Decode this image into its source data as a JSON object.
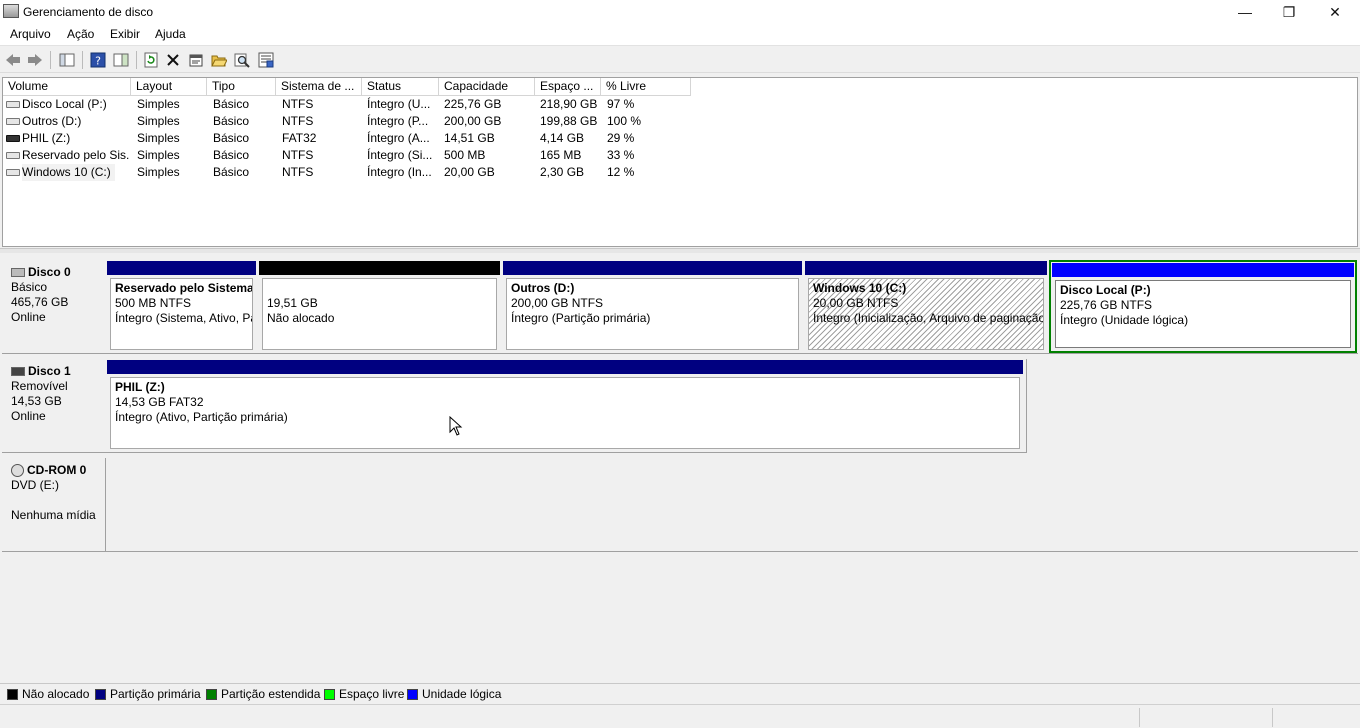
{
  "window": {
    "title": "Gerenciamento de disco",
    "minimize": "—",
    "restore": "❐",
    "close": "✕"
  },
  "menu": [
    "Arquivo",
    "Ação",
    "Exibir",
    "Ajuda"
  ],
  "toolbar": {
    "help_glyph": "?"
  },
  "volume_list": {
    "columns": [
      "Volume",
      "Layout",
      "Tipo",
      "Sistema de ...",
      "Status",
      "Capacidade",
      "Espaço ...",
      "% Livre"
    ],
    "rows": [
      {
        "volume": "Disco Local (P:)",
        "layout": "Simples",
        "tipo": "Básico",
        "fs": "NTFS",
        "status": "Íntegro (U...",
        "capacidade": "225,76 GB",
        "espaco": "218,90 GB",
        "livre": "97 %",
        "icon": "hard-drive-icon"
      },
      {
        "volume": "Outros (D:)",
        "layout": "Simples",
        "tipo": "Básico",
        "fs": "NTFS",
        "status": "Íntegro (P...",
        "capacidade": "200,00 GB",
        "espaco": "199,88 GB",
        "livre": "100 %",
        "icon": "hard-drive-icon"
      },
      {
        "volume": "PHIL (Z:)",
        "layout": "Simples",
        "tipo": "Básico",
        "fs": "FAT32",
        "status": "Íntegro (A...",
        "capacidade": "14,51 GB",
        "espaco": "4,14 GB",
        "livre": "29 %",
        "icon": "removable-drive-icon"
      },
      {
        "volume": "Reservado pelo Sis...",
        "layout": "Simples",
        "tipo": "Básico",
        "fs": "NTFS",
        "status": "Íntegro (Si...",
        "capacidade": "500 MB",
        "espaco": "165 MB",
        "livre": "33 %",
        "icon": "hard-drive-icon"
      },
      {
        "volume": "Windows 10 (C:)",
        "layout": "Simples",
        "tipo": "Básico",
        "fs": "NTFS",
        "status": "Íntegro (In...",
        "capacidade": "20,00 GB",
        "espaco": "2,30 GB",
        "livre": "12 %",
        "icon": "hard-drive-icon"
      }
    ]
  },
  "disks": [
    {
      "name": "Disco 0",
      "type": "Básico",
      "size": "465,76 GB",
      "state": "Online",
      "partitions": [
        {
          "kind": "primary",
          "name": "Reservado pelo Sistema",
          "size": "500 MB NTFS",
          "status": "Íntegro (Sistema, Ativo, Partição primária)"
        },
        {
          "kind": "unallocated",
          "name": "",
          "size": "19,51 GB",
          "status": "Não alocado"
        },
        {
          "kind": "primary",
          "name": "Outros  (D:)",
          "size": "200,00 GB NTFS",
          "status": "Íntegro (Partição primária)"
        },
        {
          "kind": "primary",
          "name": "Windows 10  (C:)",
          "size": "20,00 GB NTFS",
          "status": "Íntegro (Inicialização, Arquivo de paginação, Despejo de Memória, Partição primária)"
        },
        {
          "kind": "logical",
          "name": "Disco Local  (P:)",
          "size": "225,76 GB NTFS",
          "status": "Íntegro (Unidade lógica)"
        }
      ]
    },
    {
      "name": "Disco 1",
      "type": "Removível",
      "size": "14,53 GB",
      "state": "Online",
      "partitions": [
        {
          "kind": "primary",
          "name": "PHIL  (Z:)",
          "size": "14,53 GB FAT32",
          "status": "Íntegro (Ativo, Partição primária)"
        }
      ]
    },
    {
      "name": "CD-ROM 0",
      "type": "DVD (E:)",
      "size": "",
      "state": "Nenhuma mídia",
      "partitions": []
    }
  ],
  "legend": [
    {
      "label": "Não alocado",
      "color": "#000000"
    },
    {
      "label": "Partição primária",
      "color": "#000080"
    },
    {
      "label": "Partição estendida",
      "color": "#008000"
    },
    {
      "label": "Espaço livre",
      "color": "#00ff00"
    },
    {
      "label": "Unidade lógica",
      "color": "#0000ff"
    }
  ],
  "colors": {
    "primary_bar": "#000080",
    "unallocated_bar": "#000000",
    "logical_bar": "#0000ff",
    "selection": "#008000"
  }
}
